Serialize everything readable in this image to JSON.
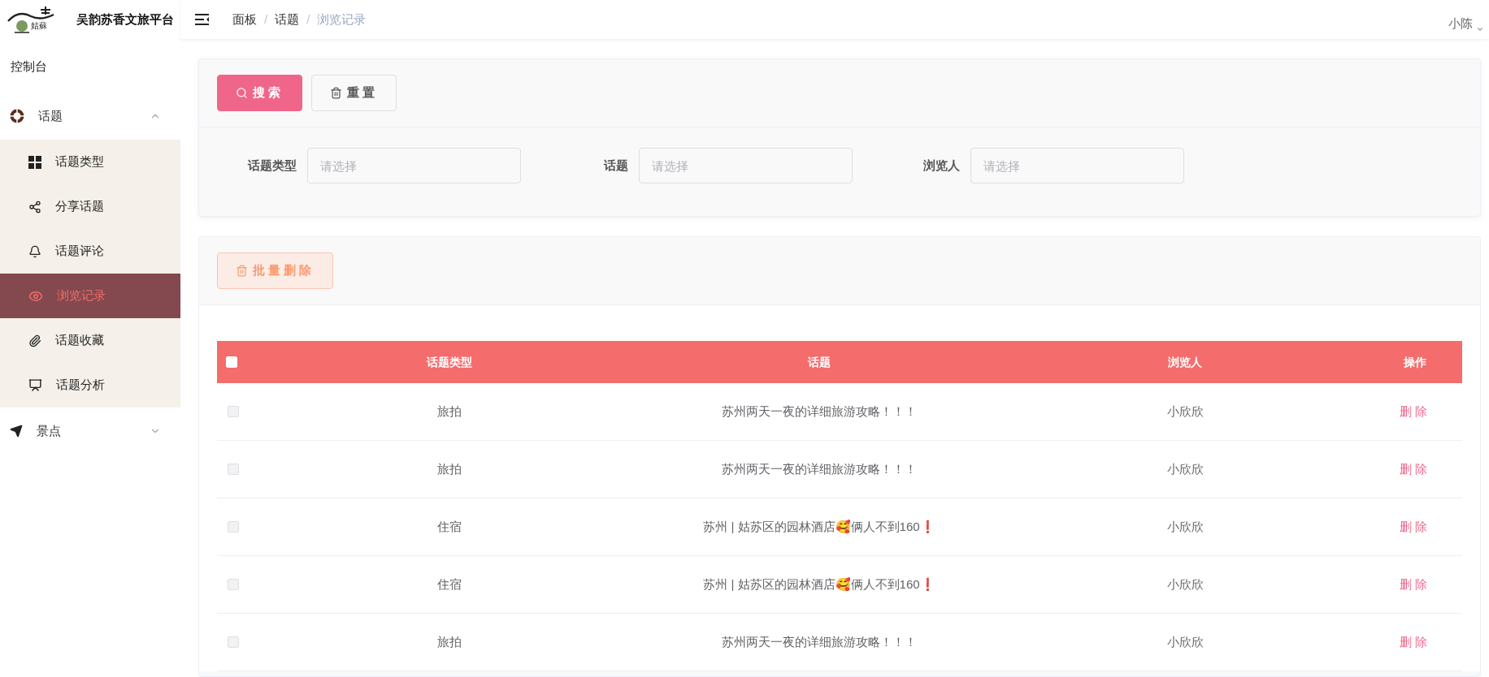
{
  "app": {
    "logo_text": "姑蘇",
    "title": "吴韵苏香文旅平台"
  },
  "breadcrumb": {
    "separator": "/",
    "items": [
      {
        "label": "面板",
        "current": false
      },
      {
        "label": "话题",
        "current": false
      },
      {
        "label": "浏览记录",
        "current": true
      }
    ]
  },
  "user": {
    "name": "小陈"
  },
  "sidebar": {
    "items": [
      {
        "label": "控制台",
        "kind": "link",
        "selected": false
      },
      {
        "label": "话题",
        "kind": "group",
        "expanded": true,
        "children": [
          {
            "label": "话题类型",
            "selected": false
          },
          {
            "label": "分享话题",
            "selected": false
          },
          {
            "label": "话题评论",
            "selected": false
          },
          {
            "label": "浏览记录",
            "selected": true
          },
          {
            "label": "话题收藏",
            "selected": false
          },
          {
            "label": "话题分析",
            "selected": false
          }
        ]
      },
      {
        "label": "景点",
        "kind": "group",
        "expanded": false
      }
    ]
  },
  "search": {
    "buttons": [
      {
        "label": "搜索",
        "kind": "primary"
      },
      {
        "label": "重置",
        "kind": "default"
      }
    ],
    "filters": [
      {
        "label": "话题类型",
        "placeholder": "请选择"
      },
      {
        "label": "话题",
        "placeholder": "请选择"
      },
      {
        "label": "浏览人",
        "placeholder": "请选择"
      }
    ]
  },
  "toolbar": {
    "batch_delete": {
      "label": "批量删除",
      "disabled": true
    }
  },
  "table": {
    "header_checked": false,
    "columns": [
      "话题类型",
      "话题",
      "浏览人",
      "操作"
    ],
    "rows": [
      {
        "checked": false,
        "type": "旅拍",
        "topic": "苏州两天一夜的详细旅游攻略！！！",
        "viewer": "小欣欣",
        "action": "删除"
      },
      {
        "checked": false,
        "type": "旅拍",
        "topic": "苏州两天一夜的详细旅游攻略！！！",
        "viewer": "小欣欣",
        "action": "删除"
      },
      {
        "checked": false,
        "type": "住宿",
        "topic": "苏州 | 姑苏区的园林酒店🥰俩人不到160❗",
        "viewer": "小欣欣",
        "action": "删除"
      },
      {
        "checked": false,
        "type": "住宿",
        "topic": "苏州 | 姑苏区的园林酒店🥰俩人不到160❗",
        "viewer": "小欣欣",
        "action": "删除"
      },
      {
        "checked": false,
        "type": "旅拍",
        "topic": "苏州两天一夜的详细旅游攻略！！！",
        "viewer": "小欣欣",
        "action": "删除"
      }
    ]
  }
}
